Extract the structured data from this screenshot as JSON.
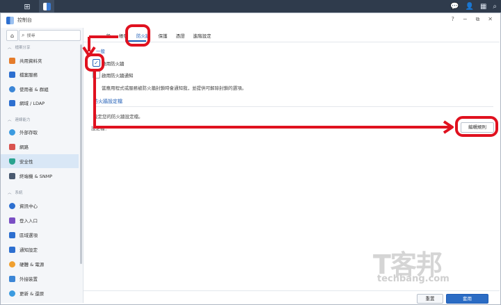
{
  "window": {
    "title": "控制台",
    "controls": [
      "?",
      "−",
      "⧉",
      "✕"
    ]
  },
  "sidebar": {
    "search_placeholder": "搜尋",
    "sections": [
      {
        "label": "檔案分享"
      },
      {
        "label": "連線能力"
      },
      {
        "label": "系統"
      }
    ],
    "items": [
      {
        "label": "共用資料夾",
        "color": "#e57c2b"
      },
      {
        "label": "檔案服務",
        "color": "#2d6fd0"
      },
      {
        "label": "使用者 & 群組",
        "color": "#3c86d6"
      },
      {
        "label": "網域 / LDAP",
        "color": "#2d6fd0"
      },
      {
        "label": "外部存取",
        "color": "#3b9be0"
      },
      {
        "label": "網路",
        "color": "#d9534f"
      },
      {
        "label": "安全性",
        "color": "#2aa38f"
      },
      {
        "label": "終端機 & SNMP",
        "color": "#4a5a70"
      },
      {
        "label": "資訊中心",
        "color": "#2d6fd0"
      },
      {
        "label": "登入入口",
        "color": "#7a4fc4"
      },
      {
        "label": "區域選項",
        "color": "#2d6fd0"
      },
      {
        "label": "通知設定",
        "color": "#2d6fd0"
      },
      {
        "label": "硬體 & 電源",
        "color": "#f0a030"
      },
      {
        "label": "外接裝置",
        "color": "#3c86d6"
      },
      {
        "label": "更新 & 還原",
        "color": "#3b9be0"
      }
    ],
    "active_index": 6
  },
  "tabs": [
    "一般",
    "帳號",
    "防火牆",
    "保護",
    "憑證",
    "進階設定"
  ],
  "active_tab": 2,
  "firewall": {
    "section_heading": "一般",
    "enable_firewall": {
      "label": "啟用防火牆",
      "checked": true
    },
    "enable_notify": {
      "label": "啟用防火牆通知",
      "checked": false
    },
    "description": "當應用程式或服務被防火牆封鎖時會通知我，並提供可解除封鎖的選項。",
    "profile_title": "防火牆設定檔",
    "profile_desc": "設定您的防火牆設定檔。",
    "profile_label": "設定檔：",
    "edit_rules_button": "編輯規則"
  },
  "footer": {
    "reset_button": "重置",
    "apply_button": "套用"
  },
  "watermark": {
    "cn": "T客邦",
    "en": "techbang.com"
  },
  "colors": {
    "accent": "#1f5db6",
    "annotation": "#e0111f",
    "taskbar": "#2f3b4c"
  }
}
